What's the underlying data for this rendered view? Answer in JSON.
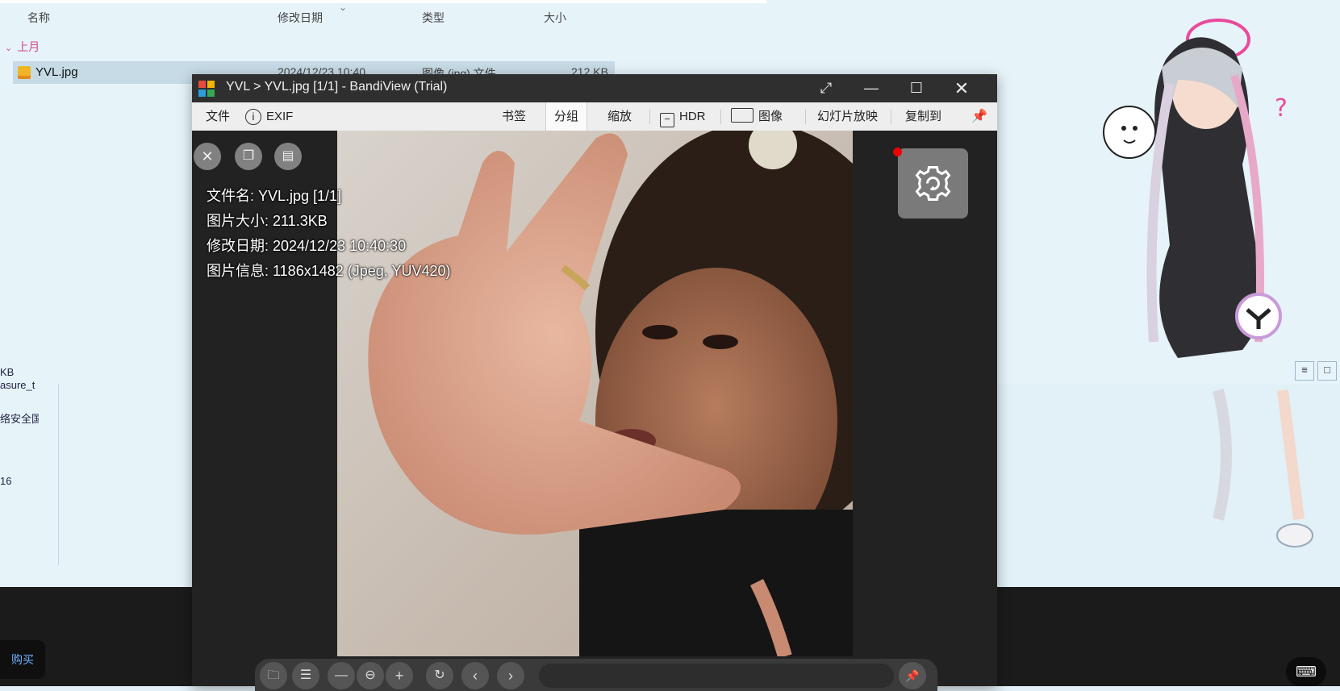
{
  "explorer": {
    "columns": [
      "名称",
      "修改日期",
      "类型",
      "大小"
    ],
    "group_label": "上月",
    "file": {
      "name": "YVL.jpg",
      "modified": "2024/12/23 10:40",
      "type": "图像 (jpg) 文件",
      "size": "212 KB"
    },
    "left_fragments": [
      "KB",
      "asure_t",
      "络安全国",
      "16"
    ],
    "view_buttons": [
      "≡",
      "□"
    ]
  },
  "taskbar": {
    "buy_label": "购买",
    "keyboard_icon": "keyboard-icon"
  },
  "viewer": {
    "title": "YVL > YVL.jpg [1/1] - BandiView (Trial)",
    "window_controls": [
      "expand-icon",
      "minimize-icon",
      "maximize-icon",
      "close-icon"
    ],
    "menu": {
      "file": "文件",
      "exif": "EXIF",
      "bookmark": "书签",
      "group": "分组",
      "zoom": "缩放",
      "hdr": "HDR",
      "image": "图像",
      "slideshow": "幻灯片放映",
      "copy_to": "复制到"
    },
    "info": {
      "filename": "文件名: YVL.jpg [1/1]",
      "size": "图片大小: 211.3KB",
      "modified": "修改日期: 2024/12/23 10:40:30",
      "info": "图片信息: 1186x1482 (Jpeg, YUV420)"
    },
    "overlay_icons": [
      "close-icon",
      "copy-icon",
      "document-icon"
    ],
    "toolbar_icons": [
      "folder-icon",
      "list-icon",
      "zoom-out-icon",
      "zoom-icon",
      "zoom-in-icon",
      "rotate-icon",
      "prev-icon",
      "next-icon",
      "pin-icon"
    ]
  }
}
